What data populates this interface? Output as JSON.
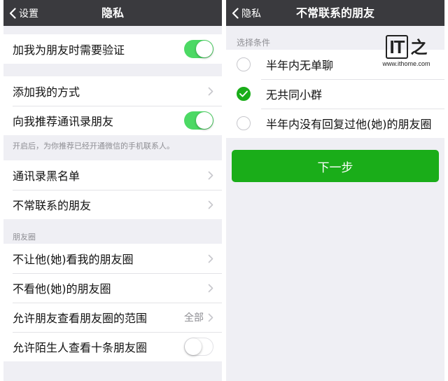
{
  "privacy": {
    "back_label": "设置",
    "title": "隐私",
    "verify_label": "加我为朋友时需要验证",
    "add_method_label": "添加我的方式",
    "recommend_label": "向我推荐通讯录朋友",
    "recommend_hint": "开启后，为你推荐已经开通微信的手机联系人。",
    "blacklist_label": "通讯录黑名单",
    "infrequent_label": "不常联系的朋友",
    "moments_header": "朋友圈",
    "hide_my_moments_label": "不让他(她)看我的朋友圈",
    "hide_their_moments_label": "不看他(她)的朋友圈",
    "moments_range_label": "允许朋友查看朋友圈的范围",
    "moments_range_value": "全部",
    "stranger_moments_label": "允许陌生人查看十条朋友圈"
  },
  "infrequent": {
    "back_label": "隐私",
    "title": "不常联系的朋友",
    "section_header": "选择条件",
    "options": [
      {
        "label": "半年内无单聊",
        "checked": false
      },
      {
        "label": "无共同小群",
        "checked": true
      },
      {
        "label": "半年内没有回复过他(她)的朋友圈",
        "checked": false
      }
    ],
    "next_label": "下一步"
  },
  "watermark": {
    "logo_it": "IT",
    "logo_zhi": "之",
    "url": "www.ithome.com"
  },
  "colors": {
    "navbar": "#3a3a3e",
    "toggle_on": "#4cd964",
    "accent_green": "#1aad19",
    "background": "#efeff4"
  }
}
